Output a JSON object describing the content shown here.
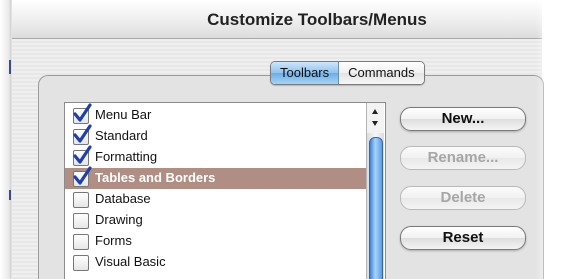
{
  "window": {
    "title": "Customize Toolbars/Menus"
  },
  "tabs": [
    {
      "label": "Toolbars",
      "active": true
    },
    {
      "label": "Commands",
      "active": false
    }
  ],
  "toolbar_list": {
    "items": [
      {
        "label": "Menu Bar",
        "checked": true,
        "selected": false
      },
      {
        "label": "Standard",
        "checked": true,
        "selected": false
      },
      {
        "label": "Formatting",
        "checked": true,
        "selected": false
      },
      {
        "label": "Tables and Borders",
        "checked": true,
        "selected": true
      },
      {
        "label": "Database",
        "checked": false,
        "selected": false
      },
      {
        "label": "Drawing",
        "checked": false,
        "selected": false
      },
      {
        "label": "Forms",
        "checked": false,
        "selected": false
      },
      {
        "label": "Visual Basic",
        "checked": false,
        "selected": false
      }
    ]
  },
  "buttons": {
    "new_label": "New...",
    "rename_label": "Rename...",
    "delete_label": "Delete",
    "reset_label": "Reset"
  },
  "colors": {
    "selection": "#b08e84",
    "check": "#1f3fae",
    "active_tab": "#8ec2ee"
  },
  "icons": {
    "check": "checkmark-icon",
    "scroll_up": "chevron-up-icon",
    "scroll_down": "chevron-down-icon"
  }
}
